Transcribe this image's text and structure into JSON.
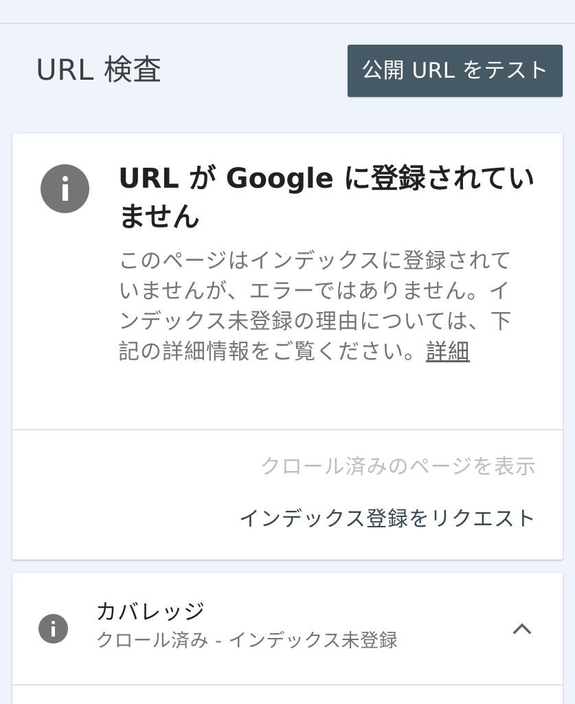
{
  "header": {
    "title": "URL 検査",
    "test_button_label": "公開 URL をテスト"
  },
  "status_card": {
    "icon": "info-icon",
    "heading": "URL が Google に登録されていません",
    "description": "このページはインデックスに登録されていませんが、エラーではありません。インデックス未登録の理由については、下記の詳細情報をご覧ください。",
    "details_link": "詳細",
    "view_crawled_page": "クロール済みのページを表示",
    "request_indexing": "インデックス登録をリクエスト"
  },
  "coverage_card": {
    "icon": "info-icon",
    "title": "カバレッジ",
    "subtitle": "クロール済み - インデックス未登録",
    "toggle_icon": "chevron-up-icon"
  },
  "colors": {
    "page_bg": "#eff3fb",
    "button_bg": "#455a64",
    "icon_gray": "#757575",
    "action_dark": "#37474f",
    "action_disabled": "#bdbdbd"
  }
}
